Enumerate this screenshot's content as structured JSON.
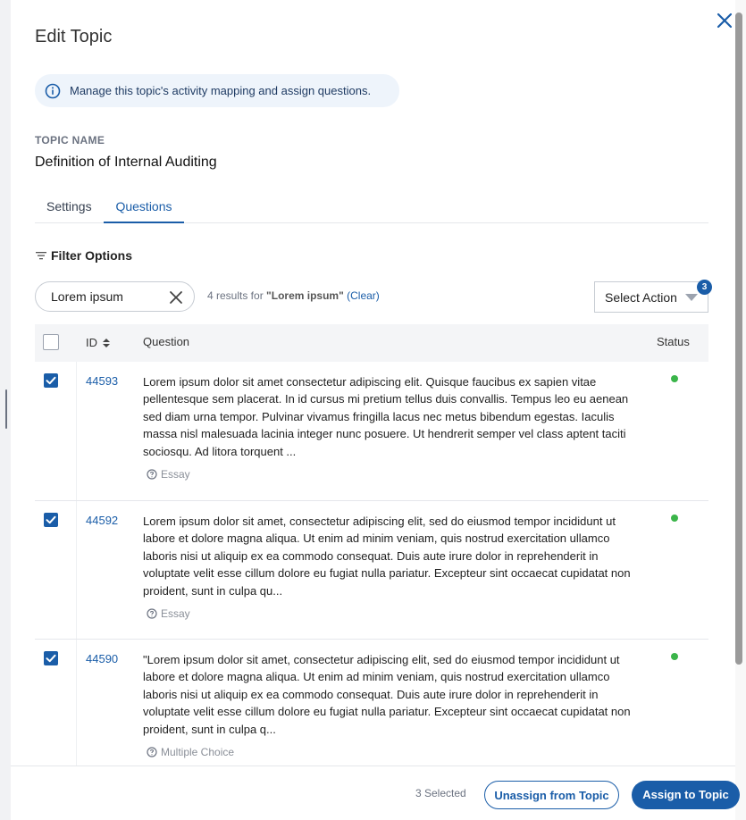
{
  "dialog": {
    "title": "Edit Topic",
    "close_icon": "close-icon"
  },
  "info_banner": {
    "icon": "info-icon",
    "text": "Manage this topic's activity mapping and assign questions."
  },
  "topic": {
    "label": "TOPIC NAME",
    "value": "Definition of Internal Auditing"
  },
  "tabs": [
    {
      "label": "Settings",
      "active": false
    },
    {
      "label": "Questions",
      "active": true
    }
  ],
  "filter": {
    "label": "Filter Options",
    "icon": "filter-icon"
  },
  "search": {
    "value": "Lorem ipsum",
    "placeholder": "",
    "clear_icon": "close-icon"
  },
  "results": {
    "prefix": "4 results for",
    "query": "\"Lorem ipsum\"",
    "clear_label": "(Clear)"
  },
  "select_action": {
    "label": "Select Action",
    "badge": "3"
  },
  "table": {
    "headers": {
      "id": "ID",
      "question": "Question",
      "status": "Status"
    },
    "rows": [
      {
        "id": "44593",
        "checked": true,
        "text": "Lorem ipsum dolor sit amet consectetur adipiscing elit. Quisque faucibus ex sapien vitae pellentesque sem placerat. In id cursus mi pretium tellus duis convallis. Tempus leo eu aenean sed diam urna tempor. Pulvinar vivamus fringilla lacus nec metus bibendum egestas. Iaculis massa nisl malesuada lacinia integer nunc posuere. Ut hendrerit semper vel class aptent taciti sociosqu. Ad litora torquent ...",
        "type": "Essay",
        "status_color": "#3bb54a"
      },
      {
        "id": "44592",
        "checked": true,
        "text": "Lorem ipsum dolor sit amet, consectetur adipiscing elit, sed do eiusmod tempor incididunt ut labore et dolore magna aliqua. Ut enim ad minim veniam, quis nostrud exercitation ullamco laboris nisi ut aliquip ex ea commodo consequat. Duis aute irure dolor in reprehenderit in voluptate velit esse cillum dolore eu fugiat nulla pariatur. Excepteur sint occaecat cupidatat non proident, sunt in culpa qu...",
        "type": "Essay",
        "status_color": "#3bb54a"
      },
      {
        "id": "44590",
        "checked": true,
        "text": "\"Lorem ipsum dolor sit amet, consectetur adipiscing elit, sed do eiusmod tempor incididunt ut labore et dolore magna aliqua. Ut enim ad minim veniam, quis nostrud exercitation ullamco laboris nisi ut aliquip ex ea commodo consequat. Duis aute irure dolor in reprehenderit in voluptate velit esse cillum dolore eu fugiat nulla pariatur. Excepteur sint occaecat cupidatat non proident, sunt in culpa q...",
        "type": "Multiple Choice",
        "status_color": "#3bb54a"
      }
    ]
  },
  "footer": {
    "selected_text": "3 Selected",
    "unassign_label": "Unassign from Topic",
    "assign_label": "Assign to Topic"
  },
  "colors": {
    "accent": "#1a5da8",
    "status_active": "#3bb54a",
    "banner_bg": "#eef4fb"
  }
}
